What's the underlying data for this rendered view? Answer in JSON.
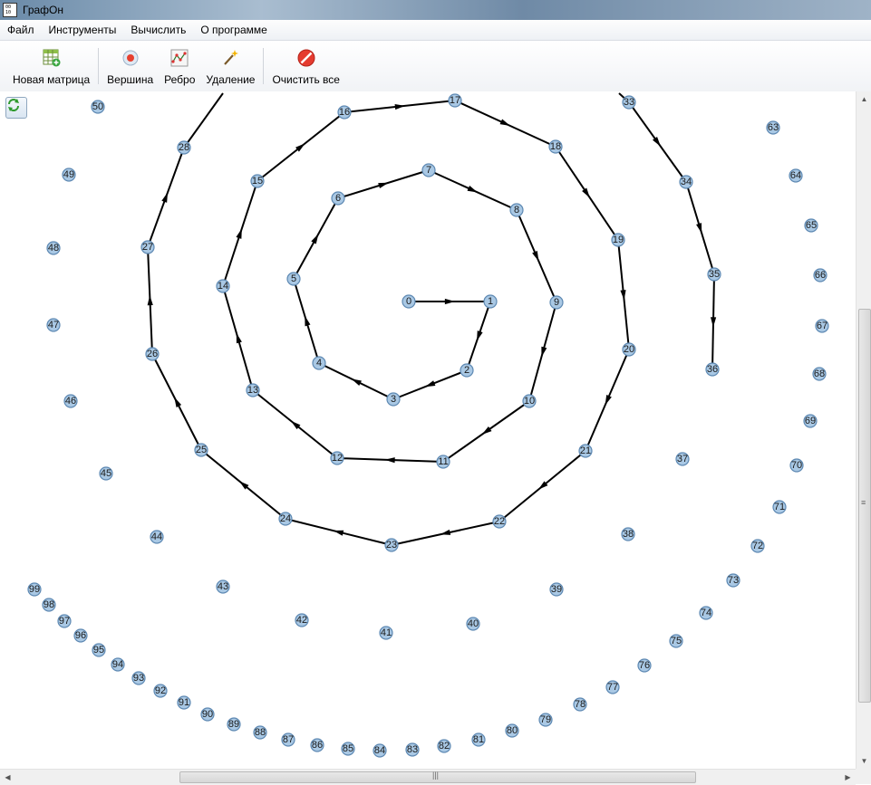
{
  "window": {
    "title": "ГрафОн",
    "app_icon_text": "0 0\n1 0"
  },
  "menu": {
    "items": [
      {
        "id": "file",
        "label": "Файл"
      },
      {
        "id": "tools",
        "label": "Инструменты"
      },
      {
        "id": "compute",
        "label": "Вычислить"
      },
      {
        "id": "about",
        "label": "О программе"
      }
    ]
  },
  "toolbar": {
    "new_matrix": {
      "label": "Новая матрица",
      "icon": "new-matrix-icon"
    },
    "vertex": {
      "label": "Вершина",
      "icon": "vertex-icon"
    },
    "edge": {
      "label": "Ребро",
      "icon": "edge-icon"
    },
    "delete": {
      "label": "Удаление",
      "icon": "magic-wand-icon"
    },
    "clear_all": {
      "label": "Очистить все",
      "icon": "stop-icon"
    }
  },
  "colors": {
    "node_fill": "#a9c8e4",
    "node_stroke": "#5d88b2",
    "edge": "#000000",
    "clear_icon": "#e53b2f"
  },
  "graph": {
    "nodes": [
      {
        "id": 0,
        "label": "0"
      },
      {
        "id": 1,
        "label": "1"
      },
      {
        "id": 2,
        "label": "2"
      },
      {
        "id": 3,
        "label": "3"
      },
      {
        "id": 4,
        "label": "4"
      },
      {
        "id": 5,
        "label": "5"
      },
      {
        "id": 6,
        "label": "6"
      },
      {
        "id": 7,
        "label": "7"
      },
      {
        "id": 8,
        "label": "8"
      },
      {
        "id": 9,
        "label": "9"
      },
      {
        "id": 10,
        "label": "10"
      },
      {
        "id": 11,
        "label": "11"
      },
      {
        "id": 12,
        "label": "12"
      },
      {
        "id": 13,
        "label": "13"
      },
      {
        "id": 14,
        "label": "14"
      },
      {
        "id": 15,
        "label": "15"
      },
      {
        "id": 16,
        "label": "16"
      },
      {
        "id": 17,
        "label": "17"
      },
      {
        "id": 18,
        "label": "18"
      },
      {
        "id": 19,
        "label": "19"
      },
      {
        "id": 20,
        "label": "20"
      },
      {
        "id": 21,
        "label": "21"
      },
      {
        "id": 22,
        "label": "22"
      },
      {
        "id": 23,
        "label": "23"
      },
      {
        "id": 24,
        "label": "24"
      },
      {
        "id": 25,
        "label": "25"
      },
      {
        "id": 26,
        "label": "26"
      },
      {
        "id": 27,
        "label": "27"
      },
      {
        "id": 28,
        "label": "28"
      },
      {
        "id": 33,
        "label": "33"
      },
      {
        "id": 34,
        "label": "34"
      },
      {
        "id": 35,
        "label": "35"
      },
      {
        "id": 36,
        "label": "36"
      },
      {
        "id": 37,
        "label": "37"
      },
      {
        "id": 38,
        "label": "38"
      },
      {
        "id": 39,
        "label": "39"
      },
      {
        "id": 40,
        "label": "40"
      },
      {
        "id": 41,
        "label": "41"
      },
      {
        "id": 42,
        "label": "42"
      },
      {
        "id": 43,
        "label": "43"
      },
      {
        "id": 44,
        "label": "44"
      },
      {
        "id": 45,
        "label": "45"
      },
      {
        "id": 46,
        "label": "46"
      },
      {
        "id": 47,
        "label": "47"
      },
      {
        "id": 48,
        "label": "48"
      },
      {
        "id": 49,
        "label": "49"
      },
      {
        "id": 50,
        "label": "50"
      },
      {
        "id": 63,
        "label": "63"
      },
      {
        "id": 64,
        "label": "64"
      },
      {
        "id": 65,
        "label": "65"
      },
      {
        "id": 66,
        "label": "66"
      },
      {
        "id": 67,
        "label": "67"
      },
      {
        "id": 68,
        "label": "68"
      },
      {
        "id": 69,
        "label": "69"
      },
      {
        "id": 70,
        "label": "70"
      },
      {
        "id": 71,
        "label": "71"
      },
      {
        "id": 72,
        "label": "72"
      },
      {
        "id": 73,
        "label": "73"
      },
      {
        "id": 74,
        "label": "74"
      },
      {
        "id": 75,
        "label": "75"
      },
      {
        "id": 76,
        "label": "76"
      },
      {
        "id": 77,
        "label": "77"
      },
      {
        "id": 78,
        "label": "78"
      },
      {
        "id": 79,
        "label": "79"
      },
      {
        "id": 80,
        "label": "80"
      },
      {
        "id": 81,
        "label": "81"
      },
      {
        "id": 82,
        "label": "82"
      },
      {
        "id": 83,
        "label": "83"
      },
      {
        "id": 84,
        "label": "84"
      },
      {
        "id": 85,
        "label": "85"
      },
      {
        "id": 86,
        "label": "86"
      },
      {
        "id": 87,
        "label": "87"
      },
      {
        "id": 88,
        "label": "88"
      },
      {
        "id": 89,
        "label": "89"
      },
      {
        "id": 90,
        "label": "90"
      },
      {
        "id": 91,
        "label": "91"
      },
      {
        "id": 92,
        "label": "92"
      },
      {
        "id": 93,
        "label": "93"
      },
      {
        "id": 94,
        "label": "94"
      },
      {
        "id": 95,
        "label": "95"
      },
      {
        "id": 96,
        "label": "96"
      },
      {
        "id": 97,
        "label": "97"
      },
      {
        "id": 98,
        "label": "98"
      },
      {
        "id": 99,
        "label": "99"
      }
    ],
    "edges": [
      [
        0,
        1
      ],
      [
        1,
        2
      ],
      [
        2,
        3
      ],
      [
        3,
        4
      ],
      [
        4,
        5
      ],
      [
        5,
        6
      ],
      [
        6,
        7
      ],
      [
        7,
        8
      ],
      [
        8,
        9
      ],
      [
        9,
        10
      ],
      [
        10,
        11
      ],
      [
        11,
        12
      ],
      [
        12,
        13
      ],
      [
        13,
        14
      ],
      [
        14,
        15
      ],
      [
        15,
        16
      ],
      [
        16,
        17
      ],
      [
        17,
        18
      ],
      [
        18,
        19
      ],
      [
        19,
        20
      ],
      [
        20,
        21
      ],
      [
        21,
        22
      ],
      [
        22,
        23
      ],
      [
        23,
        24
      ],
      [
        24,
        25
      ],
      [
        25,
        26
      ],
      [
        26,
        27
      ],
      [
        27,
        28
      ],
      [
        28,
        "top_a"
      ],
      [
        "top_b",
        33
      ],
      [
        33,
        34
      ],
      [
        34,
        35
      ],
      [
        35,
        36
      ]
    ]
  }
}
